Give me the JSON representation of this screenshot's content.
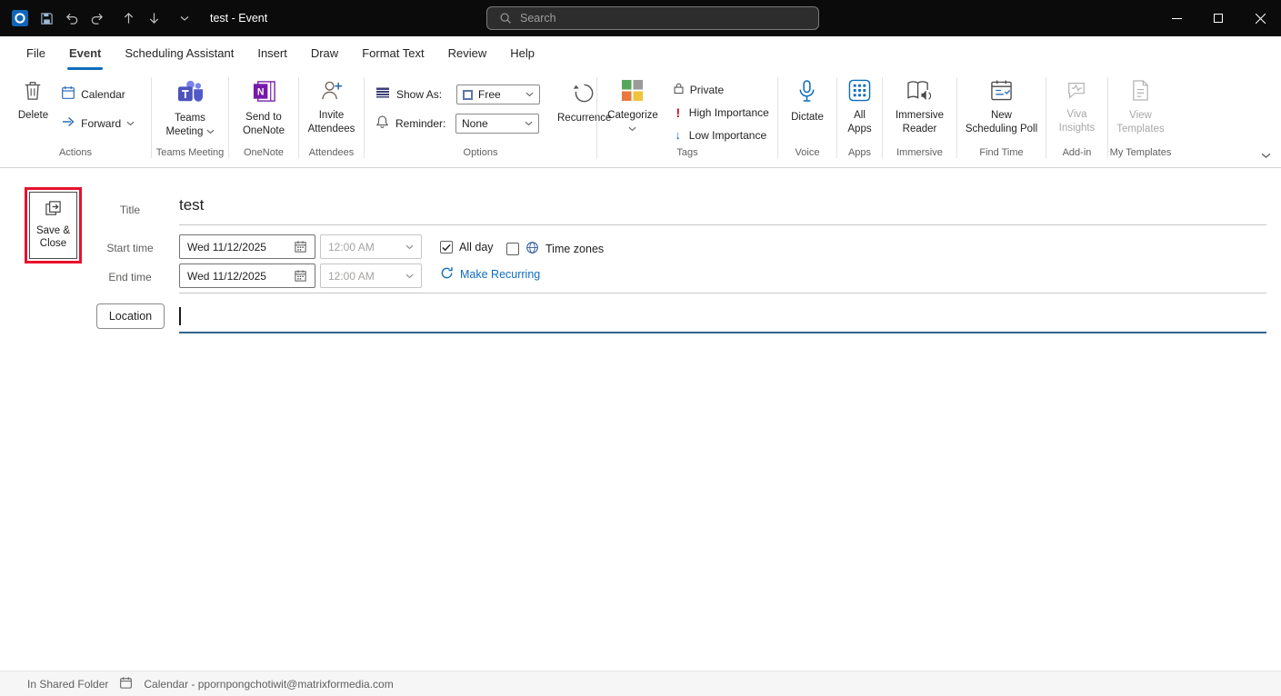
{
  "titlebar": {
    "title": "test - Event",
    "search_placeholder": "Search"
  },
  "tabs": [
    {
      "label": "File"
    },
    {
      "label": "Event"
    },
    {
      "label": "Scheduling Assistant"
    },
    {
      "label": "Insert"
    },
    {
      "label": "Draw"
    },
    {
      "label": "Format Text"
    },
    {
      "label": "Review"
    },
    {
      "label": "Help"
    }
  ],
  "ribbon": {
    "actions": {
      "group_label": "Actions",
      "delete_label": "Delete",
      "calendar_label": "Calendar",
      "forward_label": "Forward"
    },
    "teams": {
      "group_label": "Teams Meeting",
      "button_label": "Teams\nMeeting"
    },
    "onenote": {
      "group_label": "OneNote",
      "button_label": "Send to\nOneNote"
    },
    "attendees": {
      "group_label": "Attendees",
      "button_label": "Invite\nAttendees"
    },
    "options": {
      "group_label": "Options",
      "show_as_label": "Show As:",
      "show_as_value": "Free",
      "reminder_label": "Reminder:",
      "reminder_value": "None",
      "recurrence_label": "Recurrence"
    },
    "tags": {
      "group_label": "Tags",
      "categorize_label": "Categorize",
      "private_label": "Private",
      "high_label": "High Importance",
      "low_label": "Low Importance"
    },
    "voice": {
      "group_label": "Voice",
      "dictate_label": "Dictate"
    },
    "apps": {
      "group_label": "Apps",
      "all_apps_label": "All\nApps"
    },
    "immersive": {
      "group_label": "Immersive",
      "reader_label": "Immersive\nReader"
    },
    "find_time": {
      "group_label": "Find Time",
      "poll_label": "New\nScheduling Poll"
    },
    "addin": {
      "group_label": "Add-in",
      "viva_label": "Viva\nInsights"
    },
    "templates": {
      "group_label": "My Templates",
      "view_label": "View\nTemplates"
    }
  },
  "form": {
    "save_close_label": "Save &\nClose",
    "title_label": "Title",
    "title_value": "test",
    "start_time_label": "Start time",
    "start_date_value": "Wed 11/12/2025",
    "start_time_value": "12:00 AM",
    "all_day_label": "All day",
    "time_zones_label": "Time zones",
    "end_time_label": "End time",
    "end_date_value": "Wed 11/12/2025",
    "end_time_value": "12:00 AM",
    "make_recurring_label": "Make Recurring",
    "location_button_label": "Location"
  },
  "statusbar": {
    "folder_label": "In Shared Folder",
    "calendar_label": "Calendar - ppornpongchotiwit@matrixformedia.com"
  },
  "colors": {
    "accent": "#0f6cbd",
    "annotation_red": "#e8112d",
    "titlebar_bg": "#0b0b0b"
  }
}
